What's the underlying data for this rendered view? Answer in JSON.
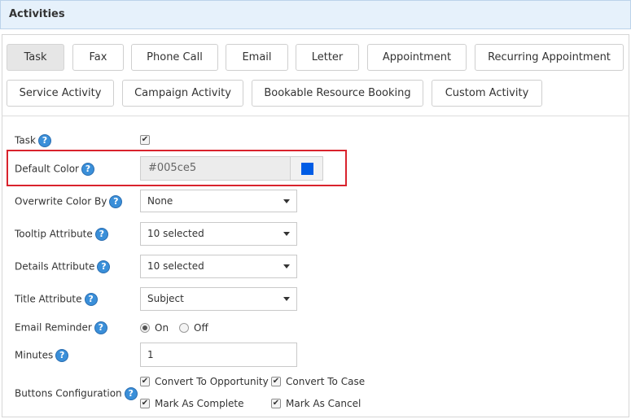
{
  "header": {
    "title": "Activities"
  },
  "tabs": [
    {
      "label": "Task",
      "active": true
    },
    {
      "label": "Fax"
    },
    {
      "label": "Phone Call"
    },
    {
      "label": "Email"
    },
    {
      "label": "Letter"
    },
    {
      "label": "Appointment"
    },
    {
      "label": "Recurring Appointment"
    },
    {
      "label": "Service Activity"
    },
    {
      "label": "Campaign Activity"
    },
    {
      "label": "Bookable Resource Booking"
    },
    {
      "label": "Custom Activity"
    }
  ],
  "help_glyph": "?",
  "check_glyph": "✔",
  "form": {
    "task": {
      "label": "Task",
      "checked": true
    },
    "default_color": {
      "label": "Default Color",
      "value": "#005ce5",
      "swatch": "#005ce5"
    },
    "overwrite_color": {
      "label": "Overwrite Color By",
      "value": "None"
    },
    "tooltip_attribute": {
      "label": "Tooltip Attribute",
      "value": "10 selected"
    },
    "details_attribute": {
      "label": "Details Attribute",
      "value": "10 selected"
    },
    "title_attribute": {
      "label": "Title Attribute",
      "value": "Subject"
    },
    "email_reminder": {
      "label": "Email Reminder",
      "on_label": "On",
      "off_label": "Off",
      "selected": "On"
    },
    "minutes": {
      "label": "Minutes",
      "value": "1"
    },
    "buttons_config": {
      "label": "Buttons Configuration",
      "options": [
        {
          "label": "Convert To Opportunity",
          "checked": true
        },
        {
          "label": "Convert To Case",
          "checked": true
        },
        {
          "label": "Mark As Complete",
          "checked": true
        },
        {
          "label": "Mark As Cancel",
          "checked": true
        }
      ]
    }
  },
  "colors": {
    "highlight": "#d9232d",
    "help": "#3a8fd9",
    "header_bg": "#e6f1fb"
  }
}
